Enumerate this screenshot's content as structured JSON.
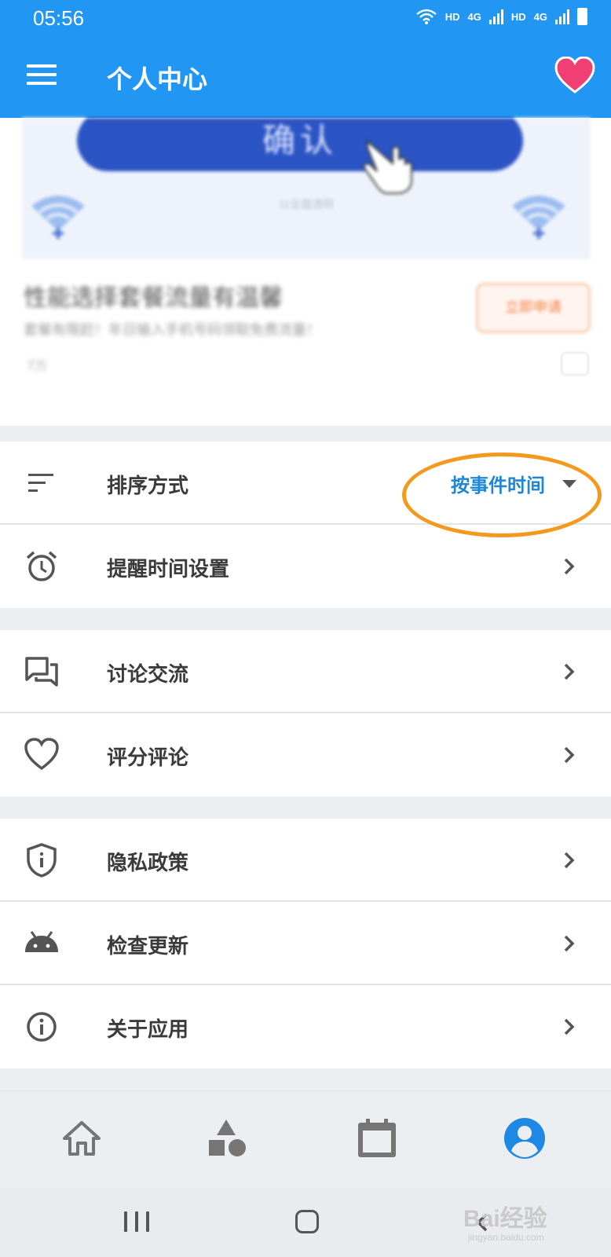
{
  "status_bar": {
    "time": "05:56",
    "network_1": "HD",
    "signal_1": "4G",
    "network_2": "HD",
    "signal_2": "4G"
  },
  "app_bar": {
    "title": "个人中心",
    "menu_icon": "hamburger-menu-icon",
    "favorite_icon": "heart-icon"
  },
  "banner": {
    "confirm_button": "确认",
    "subtitle": "以全面透明",
    "ad_title": "性能选择套餐流量有温馨",
    "ad_description": "套餐有限赶！年日输入手机号码领取免费流量！",
    "ad_meta": "7万",
    "ad_button": "立即申请"
  },
  "settings": {
    "sort": {
      "label": "排序方式",
      "value": "按事件时间",
      "icon": "sort-icon"
    },
    "reminder": {
      "label": "提醒时间设置",
      "icon": "alarm-clock-icon"
    },
    "discussion": {
      "label": "讨论交流",
      "icon": "forum-icon"
    },
    "rating": {
      "label": "评分评论",
      "icon": "heart-outline-icon"
    },
    "privacy": {
      "label": "隐私政策",
      "icon": "shield-icon"
    },
    "update": {
      "label": "检查更新",
      "icon": "android-icon"
    },
    "about": {
      "label": "关于应用",
      "icon": "info-icon"
    }
  },
  "bottom_nav": [
    {
      "name": "home",
      "icon": "home-icon",
      "active": false
    },
    {
      "name": "categories",
      "icon": "shapes-icon",
      "active": false
    },
    {
      "name": "calendar",
      "icon": "calendar-icon",
      "active": false
    },
    {
      "name": "profile",
      "icon": "account-circle-icon",
      "active": true
    }
  ],
  "watermark": {
    "brand": "Bai经验",
    "url": "jingyan.baidu.com"
  },
  "colors": {
    "primary": "#2196f3",
    "accent_value": "#1f86d6",
    "highlight_ring": "#f39a1e",
    "active_nav": "#1e88e5",
    "inactive_nav": "#757575"
  }
}
